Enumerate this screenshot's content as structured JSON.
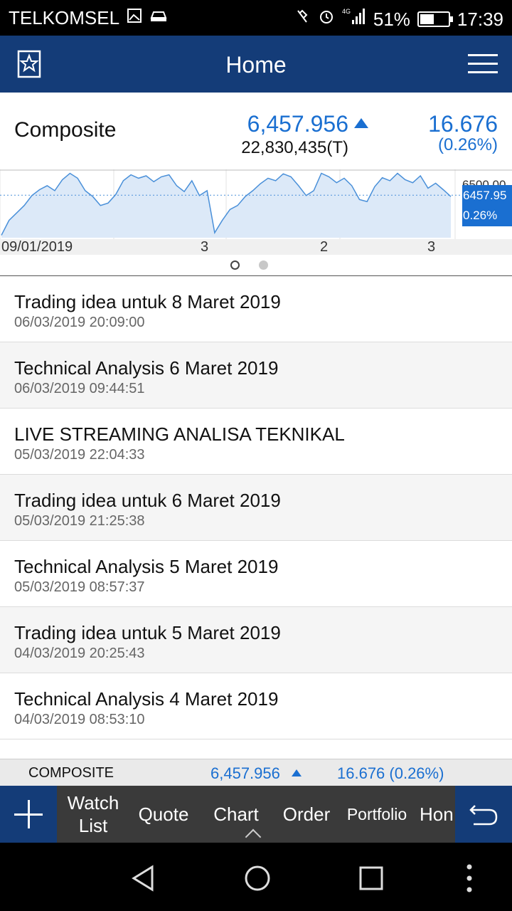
{
  "status_bar": {
    "carrier": "TELKOMSEL",
    "network": "4G",
    "battery": "51%",
    "battery_level": 0.51,
    "time": "17:39"
  },
  "app_bar": {
    "title": "Home",
    "left_icon": "star-bookmark-icon",
    "right_icon": "hamburger-menu-icon"
  },
  "quote": {
    "name": "Composite",
    "price": "6,457.956",
    "direction": "up",
    "volume": "22,830,435(T)",
    "change": "16.676",
    "change_pct": "(0.26%)"
  },
  "chart_data": {
    "type": "area",
    "x_labels": [
      "09/01/2019",
      "3",
      "2",
      "3"
    ],
    "y_tick_top": "6500.00",
    "current_value_label": "6457.95",
    "current_pct_label": "0.26%",
    "values": [
      6380,
      6410,
      6425,
      6440,
      6460,
      6472,
      6480,
      6470,
      6492,
      6505,
      6495,
      6470,
      6458,
      6440,
      6445,
      6462,
      6490,
      6502,
      6495,
      6500,
      6488,
      6498,
      6502,
      6480,
      6468,
      6490,
      6460,
      6470,
      6385,
      6410,
      6432,
      6440,
      6458,
      6470,
      6484,
      6495,
      6490,
      6504,
      6498,
      6480,
      6460,
      6470,
      6505,
      6498,
      6486,
      6495,
      6480,
      6452,
      6448,
      6478,
      6496,
      6490,
      6505,
      6492,
      6486,
      6500,
      6475,
      6485,
      6472,
      6458
    ],
    "ylim": [
      6375,
      6510
    ],
    "colors": {
      "line": "#4a90d9",
      "fill": "#dce9f8",
      "label_bg": "#1a6fd1"
    }
  },
  "pager": {
    "pages": 2,
    "active": 0
  },
  "news": [
    {
      "title": "Trading idea untuk 8 Maret 2019",
      "date": "06/03/2019 20:09:00"
    },
    {
      "title": "Technical Analysis 6 Maret 2019",
      "date": "06/03/2019 09:44:51"
    },
    {
      "title": "LIVE STREAMING ANALISA TEKNIKAL",
      "date": "05/03/2019 22:04:33"
    },
    {
      "title": "Trading idea untuk 6 Maret 2019",
      "date": "05/03/2019 21:25:38"
    },
    {
      "title": "Technical Analysis 5 Maret 2019",
      "date": "05/03/2019 08:57:37"
    },
    {
      "title": "Trading idea untuk 5 Maret 2019",
      "date": "04/03/2019 20:25:43"
    },
    {
      "title": "Technical Analysis 4 Maret 2019",
      "date": "04/03/2019 08:53:10"
    }
  ],
  "ticker": {
    "name": "COMPOSITE",
    "price": "6,457.956",
    "change": "16.676 (0.26%)"
  },
  "bottom_nav": {
    "add_icon": "plus-icon",
    "back_icon": "undo-icon",
    "tabs": [
      {
        "label": "Watch List"
      },
      {
        "label": "Quote"
      },
      {
        "label": "Chart"
      },
      {
        "label": "Order"
      },
      {
        "label": "Portfolio"
      },
      {
        "label": "Hon"
      }
    ]
  },
  "system_nav": {
    "back_icon": "triangle-back-icon",
    "home_icon": "circle-home-icon",
    "recents_icon": "square-recents-icon",
    "more_icon": "vertical-dots-icon"
  }
}
